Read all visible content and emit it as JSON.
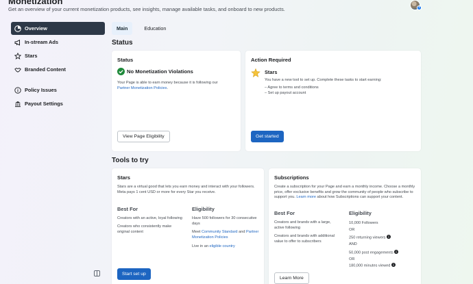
{
  "header": {
    "title": "Monetization",
    "subtitle": "Get an overview of your current monetization products, see insights, manage available tasks, and onboard to new products."
  },
  "sidebar": {
    "items": [
      {
        "label": "Overview",
        "icon": "overview-icon",
        "active": true
      },
      {
        "label": "In-stream Ads",
        "icon": "megaphone-icon"
      },
      {
        "label": "Stars",
        "icon": "star-icon"
      },
      {
        "label": "Branded Content",
        "icon": "handshake-icon"
      },
      {
        "label": "Policy Issues",
        "icon": "info-icon"
      },
      {
        "label": "Payout Settings",
        "icon": "bank-icon"
      }
    ]
  },
  "tabs": [
    {
      "label": "Main",
      "active": true
    },
    {
      "label": "Education",
      "active": false
    }
  ],
  "status_section": {
    "title": "Status",
    "status_card": {
      "title": "Status",
      "violations": "No Monetization Violations",
      "desc": "Your Page is able to earn money because it is following our",
      "link": "Partner Monetization Policies",
      "link_end": ".",
      "button": "View Page Eligibility"
    },
    "action_card": {
      "title": "Action Required",
      "item_title": "Stars",
      "desc": "You have a new tool to set up. Complete these tasks to start earning:",
      "tasks": [
        "– Agree to terms and conditions",
        "– Set up payout account"
      ],
      "button": "Get started"
    }
  },
  "tools_section": {
    "title": "Tools to try",
    "stars_card": {
      "title": "Stars",
      "desc": "Stars are a virtual good that lets you earn money and interact with your followers. Meta pays 1 cent USD or more for every Star you receive.",
      "best_for_title": "Best For",
      "best_for": [
        "Creators with an active, loyal following",
        "Creators who consistently make original content"
      ],
      "eligibility_title": "Eligibility",
      "elig_1": "Have 500 followers for 30 consecutive days",
      "elig_2_prefix": "Meet",
      "elig_2_link": "Community Standard",
      "elig_2_and": "and",
      "elig_2_link2": "Partner Monetization Policies",
      "elig_3_prefix": "Live in an",
      "elig_3_link": "eligible country",
      "button": "Start set up"
    },
    "subs_card": {
      "title": "Subscriptions",
      "desc": "Create a subscription for your Page and earn a monthly income. Choose a monthly price, offer exclusive benefits and grow the community of people who subscribe to support you.",
      "learn_link": "Learn more",
      "desc_end": "about how Subscriptions can support your content.",
      "best_for_title": "Best For",
      "best_for": [
        "Creators and brands with a large, active following",
        "Creators and brands with additional value to offer to subscribers"
      ],
      "eligibility_title": "Eligibility",
      "elig": [
        "10,000 Followers",
        "OR",
        "250 returning viewers",
        "AND",
        "50,000 post engagements",
        "OR",
        "180,000 minutes viewed"
      ],
      "button": "Learn More"
    }
  },
  "colors": {
    "accent": "#1d65c1",
    "active_nav": "#2d3847",
    "success": "#1f8a3b"
  }
}
